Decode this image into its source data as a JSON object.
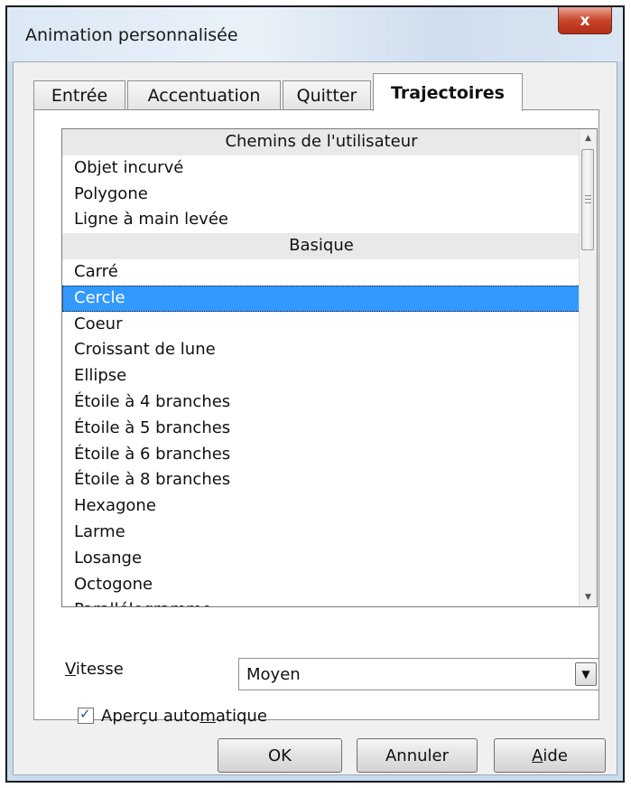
{
  "window": {
    "title": "Animation personnalisée",
    "close_label": "x"
  },
  "tabs": [
    {
      "label": "Entrée"
    },
    {
      "label": "Accentuation"
    },
    {
      "label": "Quitter"
    },
    {
      "label": "Trajectoires",
      "active": true
    }
  ],
  "list": {
    "selected": "Cercle",
    "rows": [
      {
        "label": "Chemins de l'utilisateur",
        "header": true
      },
      {
        "label": "Objet incurvé"
      },
      {
        "label": "Polygone"
      },
      {
        "label": "Ligne à main levée"
      },
      {
        "label": "Basique",
        "header": true
      },
      {
        "label": "Carré"
      },
      {
        "label": "Cercle"
      },
      {
        "label": "Coeur"
      },
      {
        "label": "Croissant de lune"
      },
      {
        "label": "Ellipse"
      },
      {
        "label": "Étoile à 4 branches"
      },
      {
        "label": "Étoile à 5 branches"
      },
      {
        "label": "Étoile à 6 branches"
      },
      {
        "label": "Étoile à 8 branches"
      },
      {
        "label": "Hexagone"
      },
      {
        "label": "Larme"
      },
      {
        "label": "Losange"
      },
      {
        "label": "Octogone"
      },
      {
        "label": "Parallélogramme"
      }
    ]
  },
  "speed": {
    "label_first": "V",
    "label_rest": "itesse",
    "value": "Moyen"
  },
  "auto_preview": {
    "label_a": "Aperçu auto",
    "label_u": "m",
    "label_b": "atique",
    "checked": true
  },
  "buttons": {
    "ok": "OK",
    "cancel": "Annuler",
    "help_first": "A",
    "help_rest": "ide"
  },
  "colors": {
    "selection": "#3399ff",
    "close": "#c8452c"
  },
  "icons": {
    "close": "close-icon",
    "dropdown": "chevron-down-icon",
    "check": "check-icon"
  }
}
